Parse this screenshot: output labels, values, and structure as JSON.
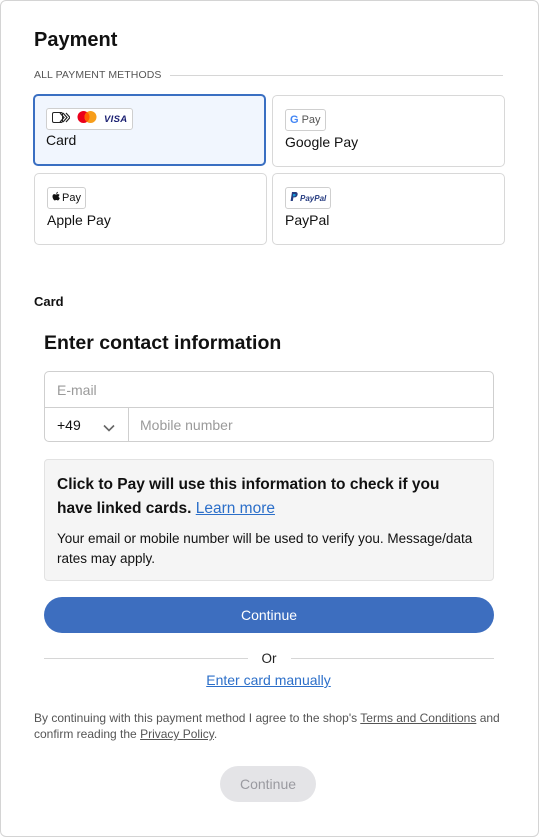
{
  "payment": {
    "title": "Payment",
    "all_methods_label": "ALL PAYMENT METHODS",
    "methods": [
      {
        "label": "Card",
        "selected": true,
        "logos": [
          "card-stripes-icon",
          "mastercard-icon",
          "visa-icon"
        ],
        "visa_text": "VISA"
      },
      {
        "label": "Google Pay",
        "selected": false,
        "logo_text": "Pay"
      },
      {
        "label": "Apple Pay",
        "selected": false,
        "logo_text": "Pay"
      },
      {
        "label": "PayPal",
        "selected": false,
        "logo_text": "PayPal"
      }
    ]
  },
  "card_section": {
    "heading": "Card",
    "contact_title": "Enter contact information",
    "email_placeholder": "E-mail",
    "email_value": "",
    "country_code": "+49",
    "mobile_placeholder": "Mobile number",
    "mobile_value": "",
    "info_text": "Click to Pay will use this information to check if you have linked cards.",
    "learn_more": "Learn more",
    "info_subtext": "Your email or mobile number will be used to verify you. Message/data rates may apply.",
    "continue_label": "Continue",
    "or_label": "Or",
    "manual_link": "Enter card manually"
  },
  "legal": {
    "prefix": "By continuing with this payment method I agree to the shop's",
    "terms_link": "Terms and Conditions",
    "middle": "and confirm reading the",
    "privacy_link": "Privacy Policy",
    "suffix": "."
  },
  "footer": {
    "continue_label": "Continue",
    "continue_enabled": false
  },
  "colors": {
    "accent": "#3d6ebf",
    "selected_border": "#3a6fc2",
    "selected_bg": "#f1f6fe",
    "link": "#2c6fc9",
    "disabled_bg": "#e4e4e7"
  }
}
